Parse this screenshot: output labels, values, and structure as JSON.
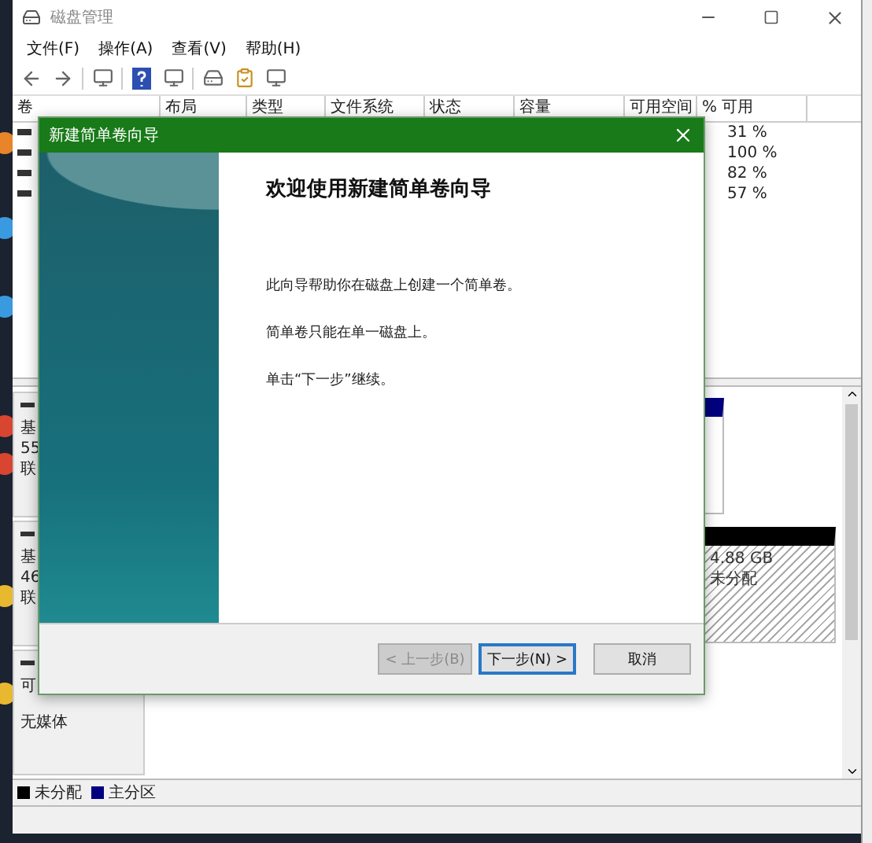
{
  "window": {
    "title": "磁盘管理"
  },
  "menu": [
    {
      "label": "文件(F)"
    },
    {
      "label": "操作(A)"
    },
    {
      "label": "查看(V)"
    },
    {
      "label": "帮助(H)"
    }
  ],
  "volume_table": {
    "columns": [
      "卷",
      "布局",
      "类型",
      "文件系统",
      "状态",
      "容量",
      "可用空间",
      "% 可用"
    ],
    "rows": [
      {
        "percent_free": "31 %"
      },
      {
        "percent_free": "100 %"
      },
      {
        "percent_free": "82 %"
      },
      {
        "percent_free": "57 %"
      }
    ]
  },
  "disks": [
    {
      "kind": "basic",
      "label_lines": [
        "基",
        "55",
        "联"
      ],
      "partitions": [
        {
          "kind": "primary"
        }
      ]
    },
    {
      "kind": "basic",
      "label_lines": [
        "基",
        "46",
        "联"
      ],
      "partitions": [
        {
          "kind": "unallocated",
          "size": "4.88 GB",
          "status": "未分配"
        }
      ]
    },
    {
      "kind": "cdrom",
      "label_lines": [
        "可",
        "无媒体"
      ]
    }
  ],
  "legend": [
    {
      "label": "未分配",
      "color": "#000000"
    },
    {
      "label": "主分区",
      "color": "#000080"
    }
  ],
  "dialog": {
    "title": "新建简单卷向导",
    "heading": "欢迎使用新建简单卷向导",
    "paragraphs": [
      "此向导帮助你在磁盘上创建一个简单卷。",
      "简单卷只能在单一磁盘上。",
      "单击“下一步”继续。"
    ],
    "buttons": [
      {
        "label": "< 上一步(B)",
        "disabled": true,
        "default": false
      },
      {
        "label": "下一步(N) >",
        "disabled": false,
        "default": true
      },
      {
        "label": "取消",
        "disabled": false,
        "default": false
      }
    ]
  }
}
